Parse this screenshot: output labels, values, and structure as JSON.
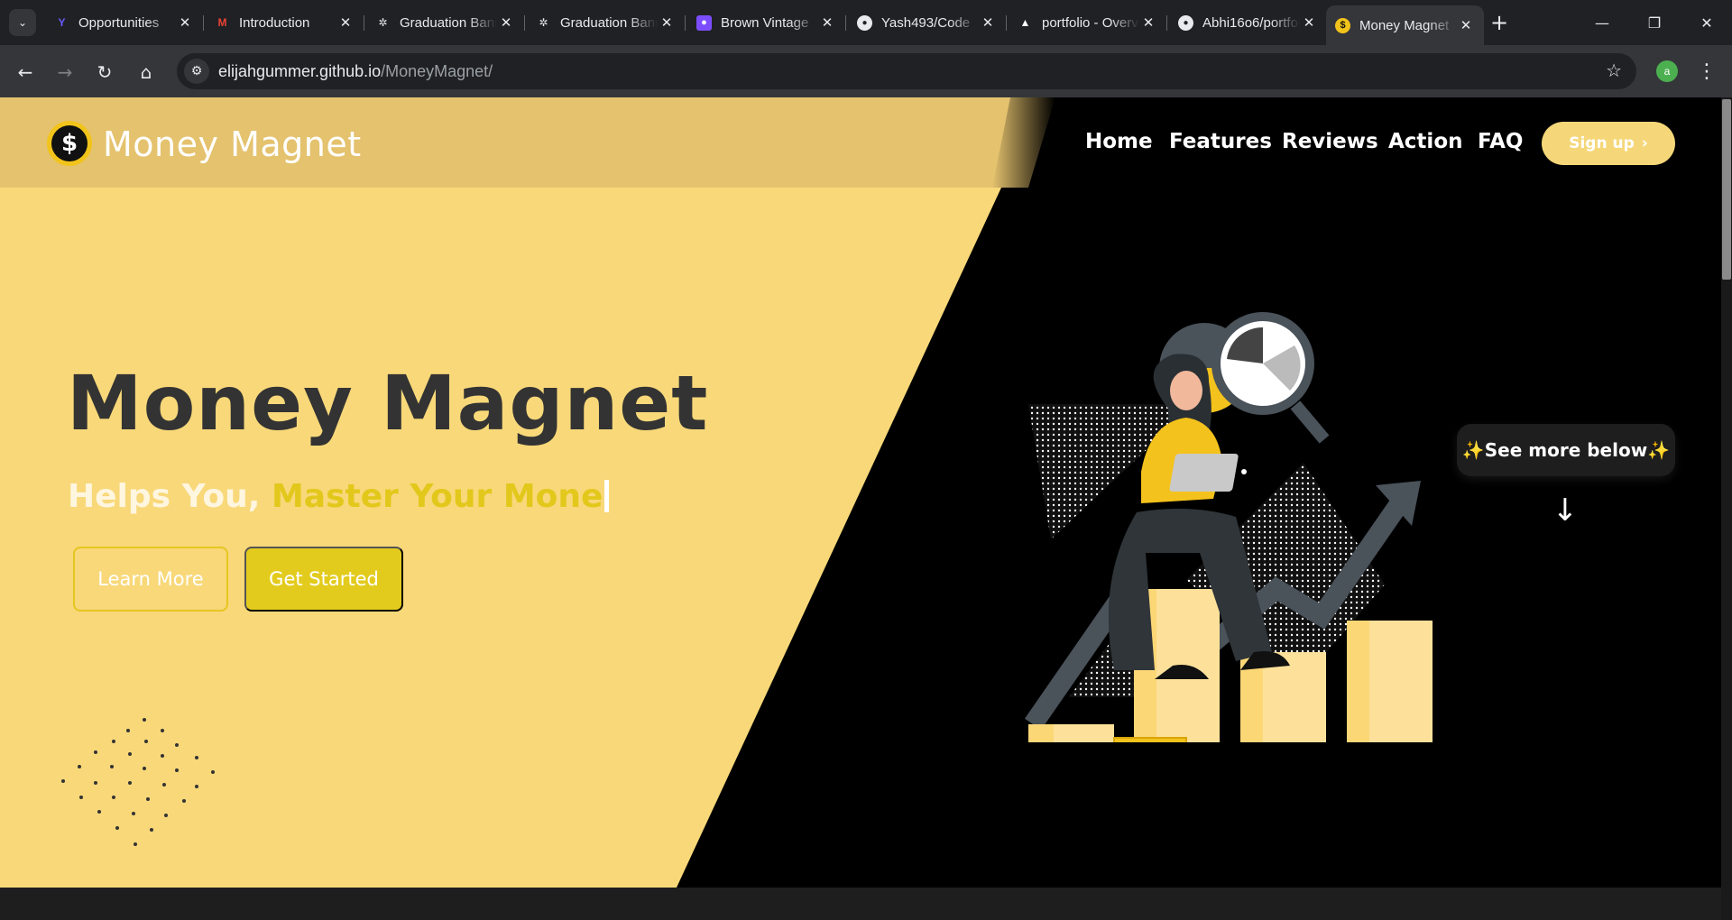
{
  "browser": {
    "tabs": [
      {
        "label": "Opportunities",
        "icon": "unstop-icon",
        "active": false
      },
      {
        "label": "Introduction",
        "icon": "gmail-icon",
        "active": false
      },
      {
        "label": "Graduation Banner",
        "icon": "chatgpt-icon",
        "active": false
      },
      {
        "label": "Graduation Banner",
        "icon": "chatgpt-icon",
        "active": false
      },
      {
        "label": "Brown Vintage",
        "icon": "canva-icon",
        "active": false
      },
      {
        "label": "Yash493/Code",
        "icon": "github-icon",
        "active": false
      },
      {
        "label": "portfolio - Overview",
        "icon": "vercel-icon",
        "active": false
      },
      {
        "label": "Abhi16o6/portfolio",
        "icon": "github-icon",
        "active": false
      },
      {
        "label": "Money Magnet",
        "icon": "money-magnet-favicon",
        "active": true
      }
    ],
    "url_host": "elijahgummer.github.io",
    "url_path": "/MoneyMagnet/",
    "profile_initial": "a"
  },
  "site": {
    "brand": "Money Magnet",
    "logo_symbol": "$",
    "nav": [
      "Home",
      "Features",
      "Reviews",
      "Action",
      "FAQ"
    ],
    "signup_label": "Sign up",
    "signup_chevron": "›",
    "hero": {
      "title": "Money Magnet",
      "subtitle_lead": "Helps You, ",
      "subtitle_typed": "Master Your Mone",
      "learn_more": "Learn More",
      "get_started": "Get Started"
    },
    "see_more": "✨See more below✨",
    "down_arrow": "↓"
  },
  "colors": {
    "hero_yellow": "#f8d879",
    "header_yellow": "#e4c26e",
    "accent_yellow": "#e3cb1e",
    "dark": "#000000",
    "title_text": "#333333"
  }
}
